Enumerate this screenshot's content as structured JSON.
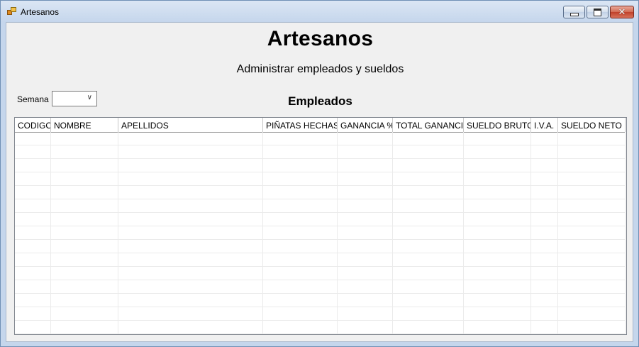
{
  "window": {
    "title": "Artesanos",
    "icon": "windows-forms-app-icon"
  },
  "header": {
    "title": "Artesanos",
    "subtitle": "Administrar empleados y sueldos"
  },
  "filter": {
    "semana_label": "Semana",
    "semana_value": ""
  },
  "section": {
    "title": "Empleados"
  },
  "table": {
    "columns": [
      "CODIGO",
      "NOMBRE",
      "APELLIDOS",
      "PIÑATAS HECHAS",
      "GANANCIA %",
      "TOTAL GANANCIA",
      "SUELDO BRUTO",
      "I.V.A.",
      "SUELDO NETO"
    ],
    "rows": []
  }
}
